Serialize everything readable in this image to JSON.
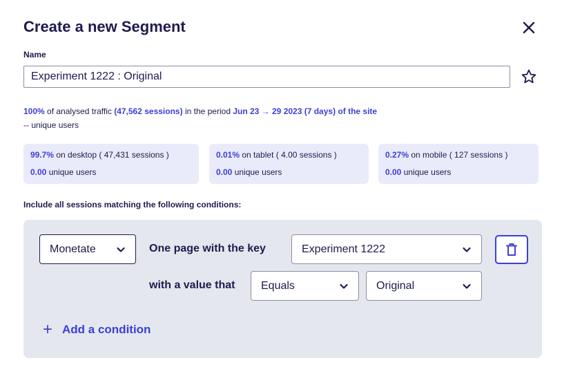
{
  "dialog": {
    "title": "Create a new Segment",
    "close_icon": "close-icon"
  },
  "name": {
    "label": "Name",
    "value": "Experiment 1222 : Original",
    "favorite_icon": "star-icon"
  },
  "traffic": {
    "percent": "100%",
    "text_a": " of analysed traffic ",
    "sessions": "(47,562 sessions)",
    "text_b": " in the period ",
    "period": "Jun 23 → 29 2023 (7 days) of the site",
    "unique_users": "-- unique users"
  },
  "devices": [
    {
      "percent": "99.7%",
      "label": " on desktop ( 47,431 sessions )",
      "users_value": "0.00",
      "users_label": " unique users"
    },
    {
      "percent": "0.01%",
      "label": " on tablet ( 4.00 sessions )",
      "users_value": "0.00",
      "users_label": " unique users"
    },
    {
      "percent": "0.27%",
      "label": " on mobile ( 127 sessions )",
      "users_value": "0.00",
      "users_label": " unique users"
    }
  ],
  "conditions": {
    "heading": "Include all sessions matching the following conditions:",
    "source": "Monetate",
    "page_key_text": "One page with the key",
    "key_value": "Experiment 1222",
    "value_text": "with a value that",
    "operator": "Equals",
    "operand": "Original",
    "delete_icon": "trash-icon",
    "add_label": "Add a condition",
    "add_icon": "plus-icon"
  },
  "colors": {
    "accent": "#3b3fd8",
    "text": "#1e1a4d",
    "card_bg": "#eaebfa",
    "panel_bg": "#e4e8ee"
  }
}
